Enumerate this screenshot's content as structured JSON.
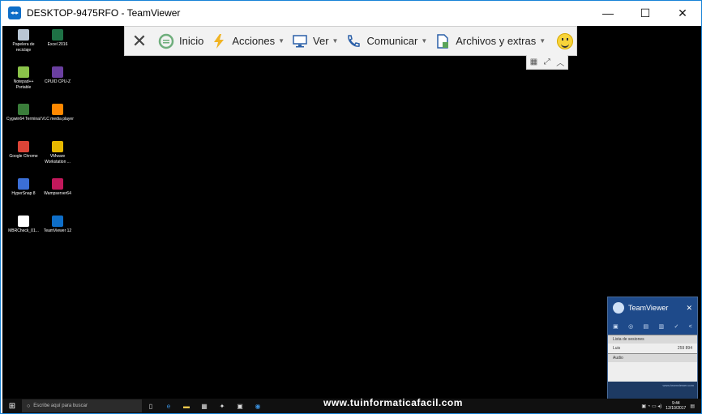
{
  "window": {
    "title": "DESKTOP-9475RFO - TeamViewer",
    "controls": {
      "minimize": "—",
      "maximize": "☐",
      "close": "✕"
    }
  },
  "toolbar": {
    "close_symbol": "✕",
    "items": [
      {
        "label": "Inicio",
        "icon": "home-icon"
      },
      {
        "label": "Acciones",
        "icon": "lightning-icon",
        "caret": "▼"
      },
      {
        "label": "Ver",
        "icon": "monitor-icon",
        "caret": "▼"
      },
      {
        "label": "Comunicar",
        "icon": "phone-icon",
        "caret": "▼"
      },
      {
        "label": "Archivos y extras",
        "icon": "files-icon",
        "caret": "▼"
      }
    ]
  },
  "subtoolbar": {
    "grid": "▦",
    "fullscreen": "⤢",
    "collapse": "︿"
  },
  "desktop": {
    "icons": [
      {
        "label": "Papelera de reciclaje",
        "color": "#b9c6d4"
      },
      {
        "label": "Excel 2016",
        "color": "#1e7145"
      },
      {
        "label": "Notepad++ Portable",
        "color": "#8bc34a"
      },
      {
        "label": "CPUID CPU-Z",
        "color": "#6a3fa0"
      },
      {
        "label": "Cygwin64 Terminal",
        "color": "#3a7d3a"
      },
      {
        "label": "VLC media player",
        "color": "#ff8800"
      },
      {
        "label": "Google Chrome",
        "color": "#db4437"
      },
      {
        "label": "VMware Workstation ...",
        "color": "#e6b800"
      },
      {
        "label": "HyperSnap 8",
        "color": "#3b6fd6"
      },
      {
        "label": "Wampserver64",
        "color": "#c2185b"
      },
      {
        "label": "MBRCheck_01...",
        "color": "#ffffff"
      },
      {
        "label": "TeamViewer 12",
        "color": "#0e6ec8"
      }
    ]
  },
  "tv_panel": {
    "brand": "TeamViewer",
    "close": "✕",
    "sessions_title": "Lista de sesiones",
    "session_user": "Luis",
    "session_id": "259 894",
    "audio_title": "Audio",
    "link": "www.teamviewer.com"
  },
  "taskbar": {
    "search_placeholder": "Escribe aquí para buscar",
    "time": "9:44",
    "date": "12/10/2017"
  },
  "watermark": "www.tuinformaticafacil.com"
}
